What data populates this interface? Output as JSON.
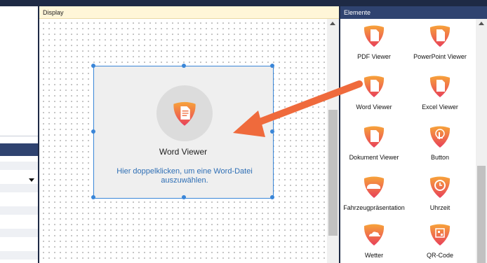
{
  "display": {
    "title": "Display"
  },
  "widget": {
    "title": "Word Viewer",
    "hint": "Hier doppelklicken, um eine Word-Datei auszuwählen."
  },
  "elements": {
    "title": "Elemente",
    "items": [
      {
        "label": "PDF Viewer",
        "icon": "pdf-doc-icon"
      },
      {
        "label": "PowerPoint Viewer",
        "icon": "ppt-doc-icon"
      },
      {
        "label": "Word Viewer",
        "icon": "word-doc-icon"
      },
      {
        "label": "Excel Viewer",
        "icon": "excel-doc-icon"
      },
      {
        "label": "Dokument Viewer",
        "icon": "document-icon"
      },
      {
        "label": "Button",
        "icon": "touch-button-icon"
      },
      {
        "label": "Fahrzeugpräsentation",
        "icon": "car-icon"
      },
      {
        "label": "Uhrzeit",
        "icon": "clock-icon"
      },
      {
        "label": "Wetter",
        "icon": "weather-icon"
      },
      {
        "label": "QR-Code",
        "icon": "qr-code-icon"
      }
    ]
  },
  "colors": {
    "accent_orange": "#ef6a3c",
    "icon_gradient_top": "#f7a33a",
    "icon_gradient_bottom": "#e8405a",
    "selection_blue": "#3a86d8",
    "panel_header": "#2f4370",
    "display_header": "#fff6d8"
  }
}
